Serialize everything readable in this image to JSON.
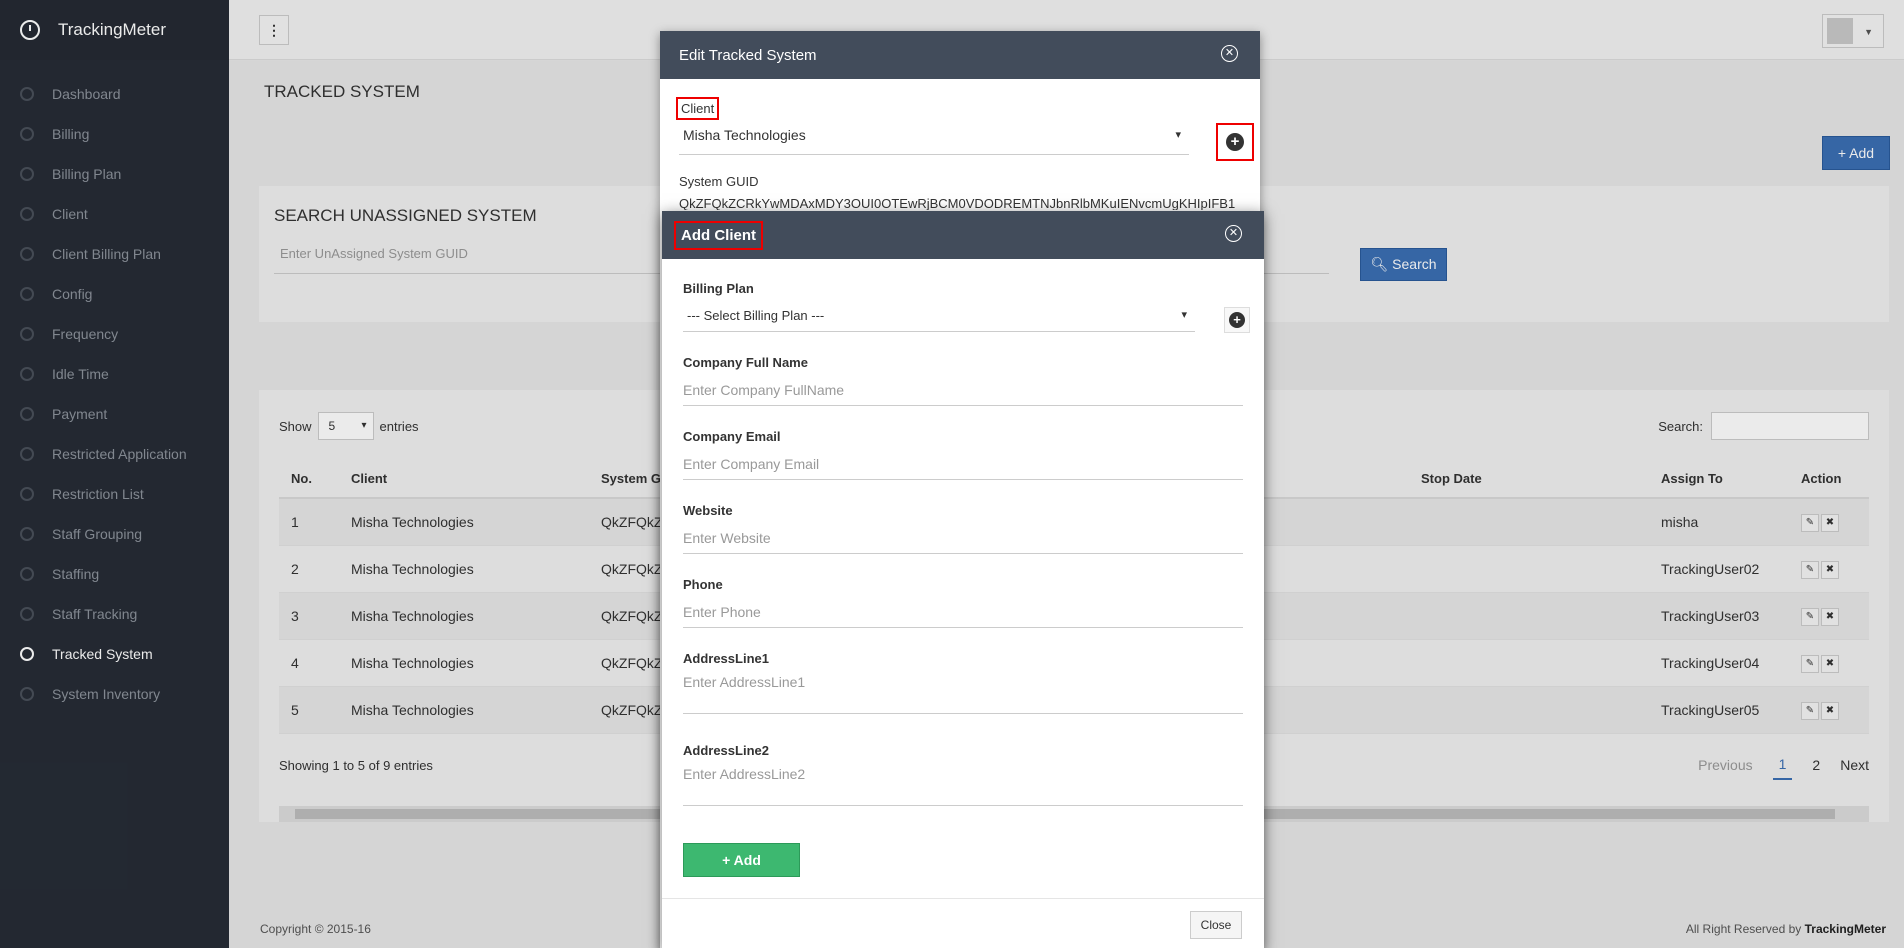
{
  "app": {
    "brand": "TrackingMeter"
  },
  "sidebar": {
    "items": [
      {
        "label": "Dashboard"
      },
      {
        "label": "Billing"
      },
      {
        "label": "Billing Plan"
      },
      {
        "label": "Client"
      },
      {
        "label": "Client Billing Plan"
      },
      {
        "label": "Config"
      },
      {
        "label": "Frequency"
      },
      {
        "label": "Idle Time"
      },
      {
        "label": "Payment"
      },
      {
        "label": "Restricted Application"
      },
      {
        "label": "Restriction List"
      },
      {
        "label": "Staff Grouping"
      },
      {
        "label": "Staffing"
      },
      {
        "label": "Staff Tracking"
      },
      {
        "label": "Tracked System"
      },
      {
        "label": "System Inventory"
      }
    ],
    "active": "Tracked System"
  },
  "topbar": {
    "kebab": "⋮"
  },
  "page": {
    "title": "TRACKED SYSTEM",
    "add_label": "+ Add",
    "search_title": "SEARCH UNASSIGNED SYSTEM",
    "search_placeholder": "Enter UnAssigned System GUID",
    "search_label": "Search"
  },
  "table": {
    "show_label": "Show",
    "show_value": "5",
    "entries_label": "entries",
    "search_label": "Search:",
    "headers": {
      "no": "No.",
      "client": "Client",
      "system": "System GU",
      "stop": "Stop Date",
      "assign": "Assign To",
      "action": "Action"
    },
    "rows": [
      {
        "no": "1",
        "client": "Misha Technologies",
        "system": "QkZFQkZ",
        "assign": "misha"
      },
      {
        "no": "2",
        "client": "Misha Technologies",
        "system": "QkZFQkZ",
        "assign": "TrackingUser02"
      },
      {
        "no": "3",
        "client": "Misha Technologies",
        "system": "QkZFQkZ",
        "assign": "TrackingUser03"
      },
      {
        "no": "4",
        "client": "Misha Technologies",
        "system": "QkZFQkZ",
        "assign": "TrackingUser04"
      },
      {
        "no": "5",
        "client": "Misha Technologies",
        "system": "QkZFQkZ",
        "assign": "TrackingUser05"
      }
    ],
    "showing": "Showing 1 to 5 of 9 entries",
    "pager": {
      "prev": "Previous",
      "p1": "1",
      "p2": "2",
      "next": "Next"
    }
  },
  "footer": {
    "copyright": "Copyright © 2015-16",
    "rights": "All Right Reserved by",
    "brand": "TrackingMeter"
  },
  "edit_modal": {
    "title": "Edit Tracked System",
    "client_label": "Client",
    "client_value": "Misha Technologies",
    "guid_label": "System GUID",
    "guid_value": "QkZFQkZCRkYwMDAxMDY3OUI0OTEwRjBCM0VDODREMTNJbnRlbMKuIENvcmUgKHIpIFB1"
  },
  "add_modal": {
    "title": "Add Client",
    "billing_label": "Billing Plan",
    "billing_value": "--- Select Billing Plan ---",
    "company_label": "Company Full Name",
    "company_placeholder": "Enter Company FullName",
    "email_label": "Company Email",
    "email_placeholder": "Enter Company Email",
    "website_label": "Website",
    "website_placeholder": "Enter Website",
    "phone_label": "Phone",
    "phone_placeholder": "Enter Phone",
    "addr1_label": "AddressLine1",
    "addr1_placeholder": "Enter AddressLine1",
    "addr2_label": "AddressLine2",
    "addr2_placeholder": "Enter AddressLine2",
    "add_label": "+ Add",
    "close_label": "Close"
  }
}
